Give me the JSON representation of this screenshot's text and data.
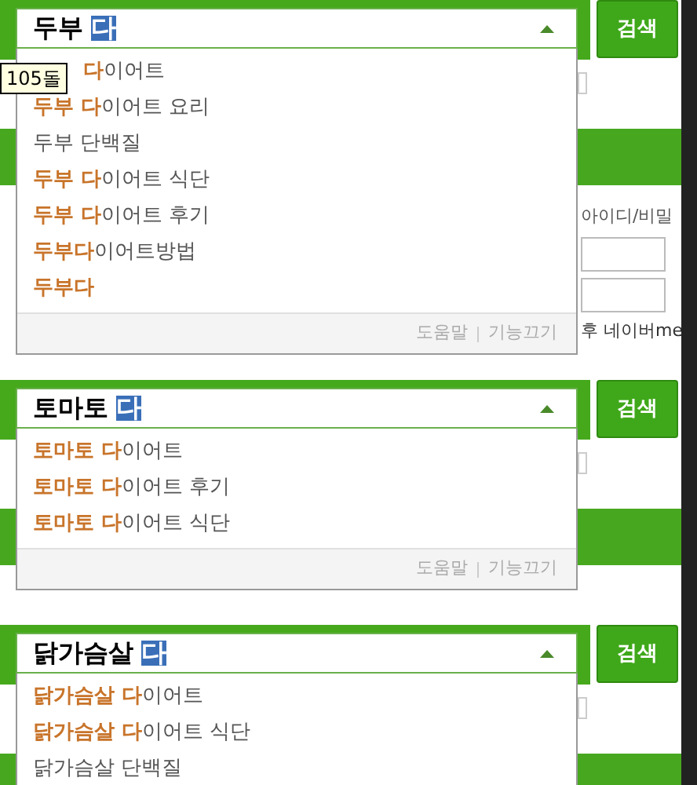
{
  "panels": [
    {
      "query": "두부",
      "composing": "다",
      "button": "검색",
      "tooltip": "105돌",
      "side_texts": [
        "아이디/비밀",
        "후 네이버me"
      ],
      "suggestions": [
        {
          "match": "다",
          "rest": "이어트",
          "covered": true
        },
        {
          "match": "두부 다",
          "rest": "이어트 요리"
        },
        {
          "rest": "두부 단백질"
        },
        {
          "match": "두부 다",
          "rest": "이어트 식단"
        },
        {
          "match": "두부 다",
          "rest": "이어트 후기"
        },
        {
          "match": "두부다",
          "rest": "이어트방법"
        },
        {
          "match": "두부다"
        }
      ],
      "footer": {
        "help": "도움말",
        "off": "기능끄기"
      }
    },
    {
      "query": "토마토",
      "composing": "다",
      "button": "검색",
      "suggestions": [
        {
          "match": "토마토 다",
          "rest": "이어트"
        },
        {
          "match": "토마토 다",
          "rest": "이어트 후기"
        },
        {
          "match": "토마토 다",
          "rest": "이어트 식단"
        }
      ],
      "footer": {
        "help": "도움말",
        "off": "기능끄기"
      }
    },
    {
      "query": "닭가슴살",
      "composing": "다",
      "button": "검색",
      "suggestions": [
        {
          "match": "닭가슴살 다",
          "rest": "이어트"
        },
        {
          "match": "닭가슴살 다",
          "rest": "이어트 식단"
        },
        {
          "rest": "닭가슴살 단백질"
        }
      ]
    }
  ]
}
